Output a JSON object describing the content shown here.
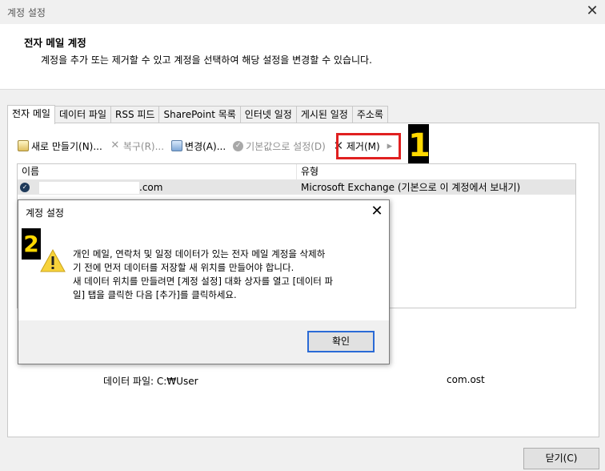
{
  "window": {
    "title": "계정 설정",
    "close_glyph": "✕"
  },
  "header": {
    "title": "전자 메일 계정",
    "description": "계정을 추가 또는 제거할 수 있고 계정을 선택하여 해당 설정을 변경할 수 있습니다."
  },
  "tabs": [
    "전자 메일",
    "데이터 파일",
    "RSS 피드",
    "SharePoint 목록",
    "인터넷 일정",
    "게시된 일정",
    "주소록"
  ],
  "toolbar": {
    "new_label": "새로 만들기(N)...",
    "repair_label": "복구(R)...",
    "change_label": "변경(A)...",
    "default_label": "기본값으로 설정(D)",
    "remove_label": "제거(M)",
    "more_glyph": "▸"
  },
  "list": {
    "col_name": "이름",
    "col_type": "유형",
    "rows": [
      {
        "name_suffix": ".com",
        "type": "Microsoft Exchange (기본으로 이 계정에서 보내기)"
      }
    ]
  },
  "datafile": {
    "label": "데이터 파일: C:₩User",
    "value": "com.ost"
  },
  "close_button": "닫기(C)",
  "annotations": {
    "step1": "1",
    "step2": "2"
  },
  "modal": {
    "title": "계정 설정",
    "close_glyph": "✕",
    "message_lines": [
      "개인 메일, 연락처 및 일정 데이터가 있는 전자 메일 계정을 삭제하",
      "기 전에 먼저 데이터를 저장할 새 위치를 만들어야 합니다.",
      "새 데이터 위치를 만들려면 [계정 설정] 대화 상자를 열고 [데이터 파",
      "일] 탭을 클릭한 다음 [추가]를 클릭하세요."
    ],
    "ok_label": "확인"
  },
  "colors": {
    "highlight": "#e02020",
    "badge_bg": "#000000",
    "badge_fg": "#ffd800",
    "ok_border": "#2a6ad6"
  }
}
